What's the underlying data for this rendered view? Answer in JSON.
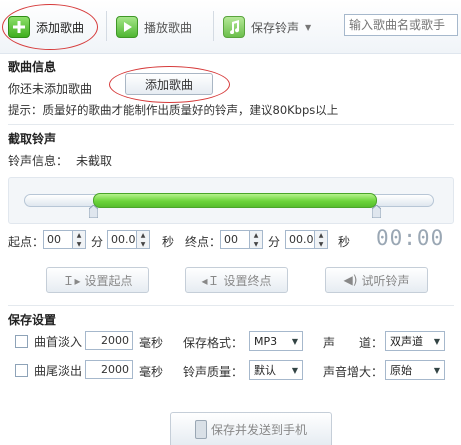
{
  "toolbar": {
    "add_song": "添加歌曲",
    "play_song": "播放歌曲",
    "save_ringtone": "保存铃声",
    "search_placeholder": "输入歌曲名或歌手"
  },
  "song_info": {
    "title": "歌曲信息",
    "status": "你还未添加歌曲",
    "add_button": "添加歌曲",
    "tip": "提示：质量好的歌曲才能制作出质量好的铃声，建议80Kbps以上"
  },
  "cut": {
    "title": "截取铃声",
    "info_label": "铃声信息：",
    "info_value": "未截取",
    "start_label": "起点：",
    "start_min": "00",
    "min_unit": "分",
    "start_sec": "00.0",
    "sec_unit": "秒",
    "end_label": "终点：",
    "end_min": "00",
    "end_sec": "00.0",
    "time_display": "00:00",
    "set_start": "设置起点",
    "set_end": "设置终点",
    "preview": "试听铃声"
  },
  "save_settings": {
    "title": "保存设置",
    "fade_in_label": "曲首淡入",
    "fade_in_value": "2000",
    "fade_out_label": "曲尾淡出",
    "fade_out_value": "2000",
    "ms_unit": "毫秒",
    "format_label": "保存格式：",
    "format_value": "MP3",
    "quality_label": "铃声质量：",
    "quality_value": "默认",
    "channel_label": "声　　道：",
    "channel_value": "双声道",
    "boost_label": "声音增大：",
    "boost_value": "原始",
    "save_send_button": "保存并发送到手机"
  },
  "colors": {
    "accent_green": "#6bd43a",
    "ring_red": "#d63b3b",
    "section_bg": "#f5f8fb"
  }
}
